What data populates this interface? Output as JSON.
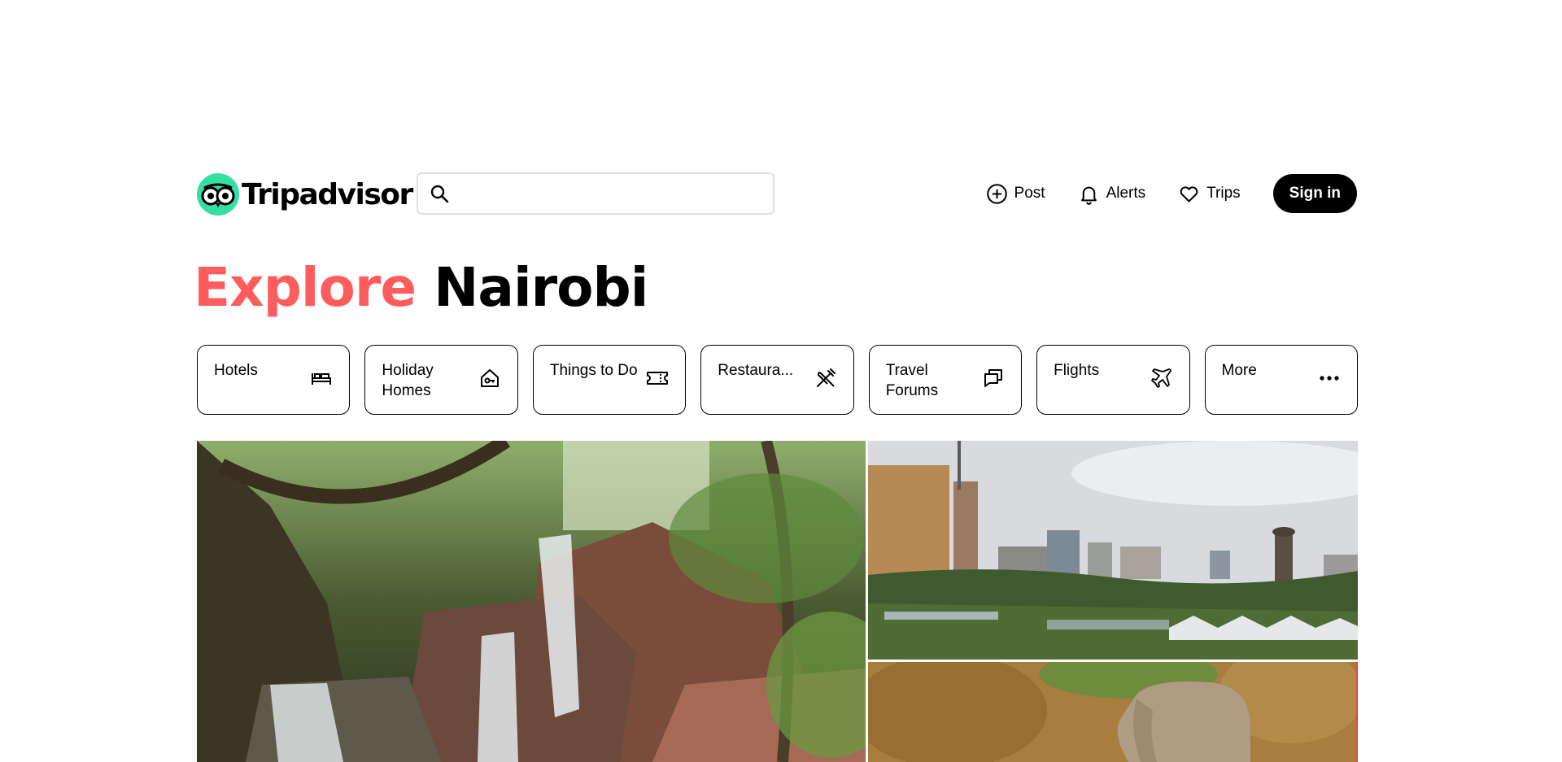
{
  "brand": {
    "name": "Tripadvisor",
    "color": "#34e0a1"
  },
  "search": {
    "placeholder": "",
    "value": "",
    "icon": "search-icon"
  },
  "nav": {
    "post": {
      "label": "Post",
      "icon": "plus-circle-icon"
    },
    "alerts": {
      "label": "Alerts",
      "icon": "bell-icon"
    },
    "trips": {
      "label": "Trips",
      "icon": "heart-icon"
    },
    "signin": {
      "label": "Sign in"
    }
  },
  "title": {
    "explore": "Explore",
    "city": "Nairobi",
    "explore_color": "#ff5d5d"
  },
  "categories": [
    {
      "label": "Hotels",
      "icon": "bed-icon"
    },
    {
      "label": "Holiday Homes",
      "icon": "house-key-icon"
    },
    {
      "label": "Things to Do",
      "icon": "ticket-icon"
    },
    {
      "label": "Restaura...",
      "icon": "fork-knife-icon"
    },
    {
      "label": "Travel Forums",
      "icon": "chat-bubbles-icon"
    },
    {
      "label": "Flights",
      "icon": "plane-icon"
    },
    {
      "label": "More",
      "icon": "more-dots-icon"
    }
  ],
  "gallery": {
    "main": "waterfall-photo",
    "top": "city-skyline-photo",
    "bottom": "elephant-photo"
  }
}
